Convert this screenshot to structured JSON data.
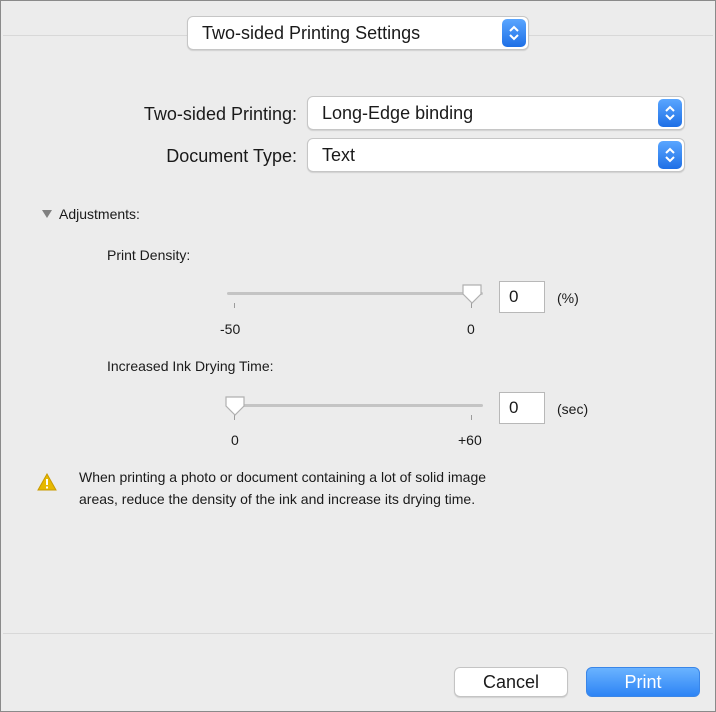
{
  "header": {
    "settings_panel_value": "Two-sided Printing Settings"
  },
  "two_sided": {
    "label": "Two-sided Printing:",
    "value": "Long-Edge binding"
  },
  "document_type": {
    "label": "Document Type:",
    "value": "Text"
  },
  "adjustments": {
    "label": "Adjustments:",
    "print_density": {
      "label": "Print Density:",
      "value": "0",
      "unit": "(%)",
      "min_label": "-50",
      "max_label": "0",
      "level": 1.0
    },
    "drying_time": {
      "label": "Increased Ink Drying Time:",
      "value": "0",
      "unit": "(sec)",
      "min_label": "0",
      "max_label": "+60",
      "level": 0.0
    }
  },
  "warning": {
    "line1": "When printing a photo or document containing a lot of solid image",
    "line2": "areas, reduce the density of the ink and increase its drying time."
  },
  "buttons": {
    "cancel": "Cancel",
    "print": "Print"
  },
  "colors": {
    "accent": "#2d84f5",
    "warning": "#e6b800"
  }
}
